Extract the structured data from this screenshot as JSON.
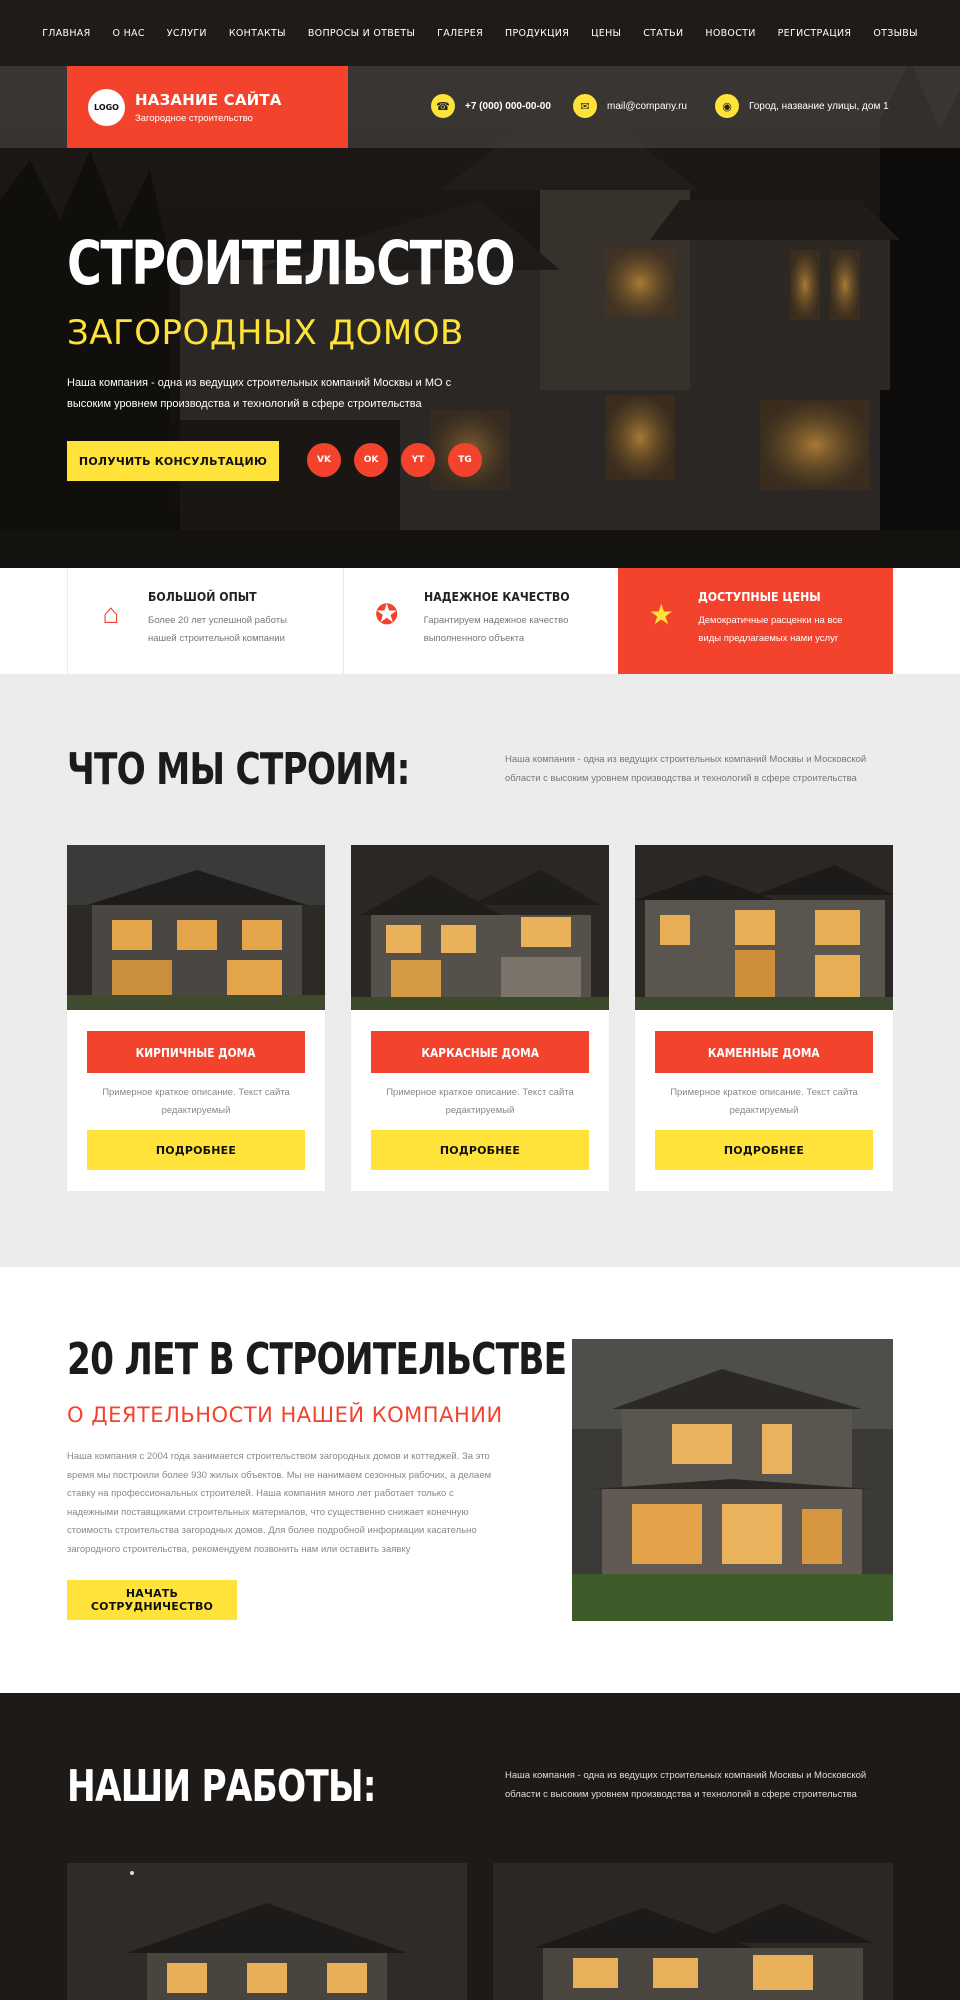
{
  "nav": {
    "items": [
      "Главная",
      "О нас",
      "Услуги",
      "Контакты",
      "Вопросы и ответы",
      "Галерея",
      "Продукция",
      "Цены",
      "Статьи",
      "Новости",
      "Регистрация",
      "Отзывы"
    ]
  },
  "header": {
    "logo_text": "LOGO",
    "site_name": "НАЗАНИЕ САЙТА",
    "site_tagline": "Загородное строительство",
    "phone": "+7 (000) 000-00-00",
    "email": "mail@company.ru",
    "address": "Город, название улицы, дом 1",
    "phone_icon": "phone-icon",
    "mail_icon": "mail-icon",
    "address_icon": "location-icon"
  },
  "hero": {
    "title": "СТРОИТЕЛЬСТВО",
    "subtitle": "ЗАГОРОДНЫХ ДОМОВ",
    "lead": "Наша компания - одна из ведущих строительных компаний Москвы и МО с высоким уровнем производства и технологий в сфере строительства",
    "cta": "ПОЛУЧИТЬ КОНСУЛЬТАЦИЮ",
    "socials": [
      "VK",
      "OK",
      "YT",
      "TG"
    ]
  },
  "features": [
    {
      "title": "БОЛЬШОЙ ОПЫТ",
      "desc": "Более 20 лет успешной работы нашей строительной компании",
      "icon": "house-icon"
    },
    {
      "title": "НАДЕЖНОЕ КАЧЕСТВО",
      "desc": "Гарантируем надежное качество выполненного объекта",
      "icon": "award-icon"
    },
    {
      "title": "ДОСТУПНЫЕ ЦЕНЫ",
      "desc": "Демократичные расценки на все виды предлагаемых нами услуг",
      "icon": "money-bag-icon"
    }
  ],
  "build": {
    "title": "ЧТО МЫ СТРОИМ:",
    "desc": "Наша компания - одна из ведущих строительных компаний Москвы и Московской области с высоким уровнем производства и технологий в сфере строительства",
    "cards": [
      {
        "tag": "КИРПИЧНЫЕ ДОМА",
        "desc": "Примерное краткое описание. Текст сайта редактируемый",
        "button": "ПОДРОБНЕЕ"
      },
      {
        "tag": "КАРКАСНЫЕ ДОМА",
        "desc": "Примерное краткое описание. Текст сайта редактируемый",
        "button": "ПОДРОБНЕЕ"
      },
      {
        "tag": "КАМЕННЫЕ ДОМА",
        "desc": "Примерное краткое описание. Текст сайта редактируемый",
        "button": "ПОДРОБНЕЕ"
      }
    ]
  },
  "years": {
    "title": "20 ЛЕТ В СТРОИТЕЛЬСТВЕ",
    "subtitle": "О ДЕЯТЕЛЬНОСТИ НАШЕЙ КОМПАНИИ",
    "text": "Наша компания с 2004 года занимается строительством загородных домов и коттеджей. За это время мы построили более 930 жилых объектов. Мы не нанимаем сезонных рабочих, а делаем ставку на профессиональных строителей. Наша компания много лет работает только с надежными поставщиками строительных материалов, что существенно снижает конечную стоимость строительства загородных домов. Для более подробной информации касательно загородного строительства, рекомендуем позвонить нам или оставить заявку",
    "cta": "НАЧАТЬ СОТРУДНИЧЕСТВО"
  },
  "works": {
    "title": "НАШИ РАБОТЫ:",
    "desc": "Наша компания - одна из ведущих строительных компаний Москвы и Московской области с высоким уровнем производства и технологий в сфере строительства"
  },
  "colors": {
    "accent": "#f4432d",
    "yellow": "#ffe33a",
    "dark": "#1e1a18"
  }
}
